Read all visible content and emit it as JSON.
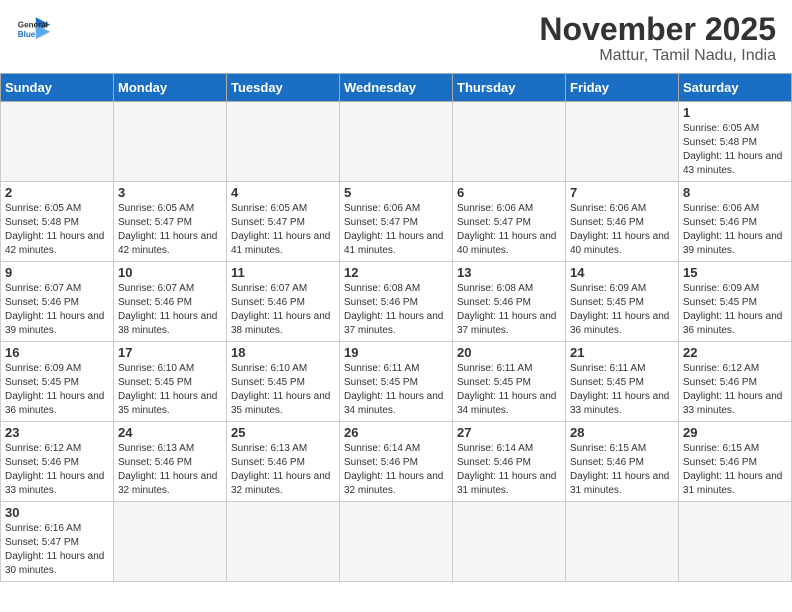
{
  "header": {
    "logo_general": "General",
    "logo_blue": "Blue",
    "month_title": "November 2025",
    "location": "Mattur, Tamil Nadu, India"
  },
  "weekdays": [
    "Sunday",
    "Monday",
    "Tuesday",
    "Wednesday",
    "Thursday",
    "Friday",
    "Saturday"
  ],
  "cells": [
    [
      {
        "day": "",
        "info": ""
      },
      {
        "day": "",
        "info": ""
      },
      {
        "day": "",
        "info": ""
      },
      {
        "day": "",
        "info": ""
      },
      {
        "day": "",
        "info": ""
      },
      {
        "day": "",
        "info": ""
      },
      {
        "day": "1",
        "info": "Sunrise: 6:05 AM\nSunset: 5:48 PM\nDaylight: 11 hours\nand 43 minutes."
      }
    ],
    [
      {
        "day": "2",
        "info": "Sunrise: 6:05 AM\nSunset: 5:48 PM\nDaylight: 11 hours\nand 42 minutes."
      },
      {
        "day": "3",
        "info": "Sunrise: 6:05 AM\nSunset: 5:47 PM\nDaylight: 11 hours\nand 42 minutes."
      },
      {
        "day": "4",
        "info": "Sunrise: 6:05 AM\nSunset: 5:47 PM\nDaylight: 11 hours\nand 41 minutes."
      },
      {
        "day": "5",
        "info": "Sunrise: 6:06 AM\nSunset: 5:47 PM\nDaylight: 11 hours\nand 41 minutes."
      },
      {
        "day": "6",
        "info": "Sunrise: 6:06 AM\nSunset: 5:47 PM\nDaylight: 11 hours\nand 40 minutes."
      },
      {
        "day": "7",
        "info": "Sunrise: 6:06 AM\nSunset: 5:46 PM\nDaylight: 11 hours\nand 40 minutes."
      },
      {
        "day": "8",
        "info": "Sunrise: 6:06 AM\nSunset: 5:46 PM\nDaylight: 11 hours\nand 39 minutes."
      }
    ],
    [
      {
        "day": "9",
        "info": "Sunrise: 6:07 AM\nSunset: 5:46 PM\nDaylight: 11 hours\nand 39 minutes."
      },
      {
        "day": "10",
        "info": "Sunrise: 6:07 AM\nSunset: 5:46 PM\nDaylight: 11 hours\nand 38 minutes."
      },
      {
        "day": "11",
        "info": "Sunrise: 6:07 AM\nSunset: 5:46 PM\nDaylight: 11 hours\nand 38 minutes."
      },
      {
        "day": "12",
        "info": "Sunrise: 6:08 AM\nSunset: 5:46 PM\nDaylight: 11 hours\nand 37 minutes."
      },
      {
        "day": "13",
        "info": "Sunrise: 6:08 AM\nSunset: 5:46 PM\nDaylight: 11 hours\nand 37 minutes."
      },
      {
        "day": "14",
        "info": "Sunrise: 6:09 AM\nSunset: 5:45 PM\nDaylight: 11 hours\nand 36 minutes."
      },
      {
        "day": "15",
        "info": "Sunrise: 6:09 AM\nSunset: 5:45 PM\nDaylight: 11 hours\nand 36 minutes."
      }
    ],
    [
      {
        "day": "16",
        "info": "Sunrise: 6:09 AM\nSunset: 5:45 PM\nDaylight: 11 hours\nand 36 minutes."
      },
      {
        "day": "17",
        "info": "Sunrise: 6:10 AM\nSunset: 5:45 PM\nDaylight: 11 hours\nand 35 minutes."
      },
      {
        "day": "18",
        "info": "Sunrise: 6:10 AM\nSunset: 5:45 PM\nDaylight: 11 hours\nand 35 minutes."
      },
      {
        "day": "19",
        "info": "Sunrise: 6:11 AM\nSunset: 5:45 PM\nDaylight: 11 hours\nand 34 minutes."
      },
      {
        "day": "20",
        "info": "Sunrise: 6:11 AM\nSunset: 5:45 PM\nDaylight: 11 hours\nand 34 minutes."
      },
      {
        "day": "21",
        "info": "Sunrise: 6:11 AM\nSunset: 5:45 PM\nDaylight: 11 hours\nand 33 minutes."
      },
      {
        "day": "22",
        "info": "Sunrise: 6:12 AM\nSunset: 5:46 PM\nDaylight: 11 hours\nand 33 minutes."
      }
    ],
    [
      {
        "day": "23",
        "info": "Sunrise: 6:12 AM\nSunset: 5:46 PM\nDaylight: 11 hours\nand 33 minutes."
      },
      {
        "day": "24",
        "info": "Sunrise: 6:13 AM\nSunset: 5:46 PM\nDaylight: 11 hours\nand 32 minutes."
      },
      {
        "day": "25",
        "info": "Sunrise: 6:13 AM\nSunset: 5:46 PM\nDaylight: 11 hours\nand 32 minutes."
      },
      {
        "day": "26",
        "info": "Sunrise: 6:14 AM\nSunset: 5:46 PM\nDaylight: 11 hours\nand 32 minutes."
      },
      {
        "day": "27",
        "info": "Sunrise: 6:14 AM\nSunset: 5:46 PM\nDaylight: 11 hours\nand 31 minutes."
      },
      {
        "day": "28",
        "info": "Sunrise: 6:15 AM\nSunset: 5:46 PM\nDaylight: 11 hours\nand 31 minutes."
      },
      {
        "day": "29",
        "info": "Sunrise: 6:15 AM\nSunset: 5:46 PM\nDaylight: 11 hours\nand 31 minutes."
      }
    ],
    [
      {
        "day": "30",
        "info": "Sunrise: 6:16 AM\nSunset: 5:47 PM\nDaylight: 11 hours\nand 30 minutes."
      },
      {
        "day": "",
        "info": ""
      },
      {
        "day": "",
        "info": ""
      },
      {
        "day": "",
        "info": ""
      },
      {
        "day": "",
        "info": ""
      },
      {
        "day": "",
        "info": ""
      },
      {
        "day": "",
        "info": ""
      }
    ]
  ]
}
